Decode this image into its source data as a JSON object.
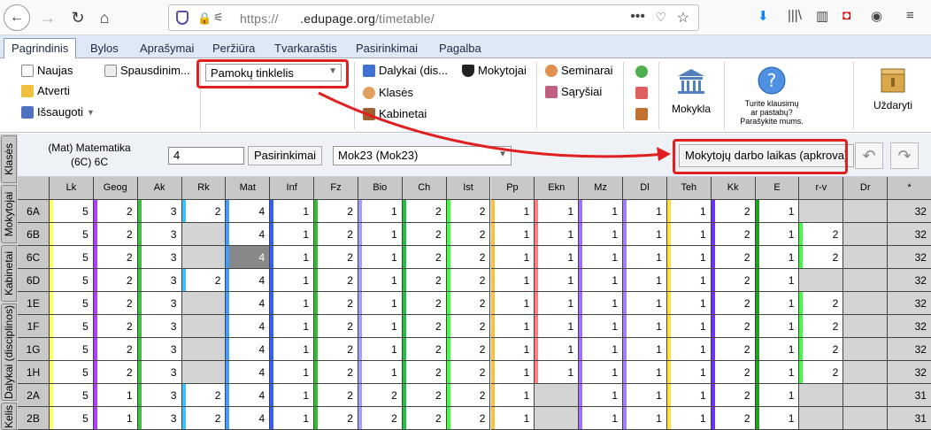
{
  "browser": {
    "url_prefix": "https://",
    "url_host": ".edupage.org",
    "url_path": "/timetable/"
  },
  "menu": {
    "tabs": [
      "Pagrindinis",
      "Bylos",
      "Aprašymai",
      "Peržiūra",
      "Tvarkaraštis",
      "Pasirinkimai",
      "Pagalba"
    ],
    "active": "Pagrindinis"
  },
  "ribbon": {
    "naujas": "Naujas",
    "atverti": "Atverti",
    "issaugoti": "Išsaugoti",
    "spausdinimas": "Spausdinim...",
    "view_select": "Pamokų tinklelis",
    "dalykai": "Dalykai (dis...",
    "klases": "Klasės",
    "kabinetai": "Kabinetai",
    "mokytojai": "Mokytojai",
    "seminarai": "Seminarai",
    "sarysiai": "Sąryšiai",
    "mokykla": "Mokykla",
    "help_line1": "Turite klausimų",
    "help_line2": "ar pastabų?",
    "help_line3": "Parašykite mums.",
    "uzdaryti": "Uždaryti"
  },
  "filter": {
    "subject_line1": "(Mat) Matematika",
    "subject_line2": "(6C) 6C",
    "number_value": "4",
    "pasirinkimai": "Pasirinkimai",
    "teacher_select": "Mok23 (Mok23)",
    "workload_button": "Mokytojų darbo laikas (apkrova)"
  },
  "sidetabs": [
    "Klasės",
    "Mokytojai",
    "Kabinetai",
    "Dalykai (disciplinos)",
    "Kelis"
  ],
  "grid": {
    "columns": [
      "Lk",
      "Geog",
      "Ak",
      "Rk",
      "Mat",
      "Inf",
      "Fz",
      "Bio",
      "Ch",
      "Ist",
      "Pp",
      "Ekn",
      "Mz",
      "Dl",
      "Teh",
      "Kk",
      "E",
      "r-v",
      "Dr",
      "*"
    ],
    "column_colors": [
      "#ffff66",
      "#b040ff",
      "#40c040",
      "#40c0ff",
      "#40a0ff",
      "#3060ff",
      "#30c030",
      "#a0a0ff",
      "#20c040",
      "#40ff40",
      "#ffc040",
      "#ff8080",
      "#a070ff",
      "#a080ff",
      "#ffe040",
      "#7030ff",
      "#20a020",
      "#40ff40",
      "#cccccc",
      "#cccccc"
    ],
    "rows": [
      {
        "label": "6A",
        "cells": [
          "5",
          "2",
          "3",
          "2",
          "4",
          "1",
          "2",
          "1",
          "2",
          "2",
          "1",
          "1",
          "1",
          "1",
          "1",
          "2",
          "1",
          "",
          "",
          "32"
        ]
      },
      {
        "label": "6B",
        "cells": [
          "5",
          "2",
          "3",
          "",
          "4",
          "1",
          "2",
          "1",
          "2",
          "2",
          "1",
          "1",
          "1",
          "1",
          "1",
          "2",
          "1",
          "2",
          "",
          "32"
        ]
      },
      {
        "label": "6C",
        "cells": [
          "5",
          "2",
          "3",
          "",
          "4",
          "1",
          "2",
          "1",
          "2",
          "2",
          "1",
          "1",
          "1",
          "1",
          "1",
          "2",
          "1",
          "2",
          "",
          "32"
        ]
      },
      {
        "label": "6D",
        "cells": [
          "5",
          "2",
          "3",
          "2",
          "4",
          "1",
          "2",
          "1",
          "2",
          "2",
          "1",
          "1",
          "1",
          "1",
          "1",
          "2",
          "1",
          "",
          "",
          "32"
        ]
      },
      {
        "label": "1E",
        "cells": [
          "5",
          "2",
          "3",
          "",
          "4",
          "1",
          "2",
          "1",
          "2",
          "2",
          "1",
          "1",
          "1",
          "1",
          "1",
          "2",
          "1",
          "2",
          "",
          "32"
        ]
      },
      {
        "label": "1F",
        "cells": [
          "5",
          "2",
          "3",
          "",
          "4",
          "1",
          "2",
          "1",
          "2",
          "2",
          "1",
          "1",
          "1",
          "1",
          "1",
          "2",
          "1",
          "2",
          "",
          "32"
        ]
      },
      {
        "label": "1G",
        "cells": [
          "5",
          "2",
          "3",
          "",
          "4",
          "1",
          "2",
          "1",
          "2",
          "2",
          "1",
          "1",
          "1",
          "1",
          "1",
          "2",
          "1",
          "2",
          "",
          "32"
        ]
      },
      {
        "label": "1H",
        "cells": [
          "5",
          "2",
          "3",
          "",
          "4",
          "1",
          "2",
          "1",
          "2",
          "2",
          "1",
          "1",
          "1",
          "1",
          "1",
          "2",
          "1",
          "2",
          "",
          "32"
        ]
      },
      {
        "label": "2A",
        "cells": [
          "5",
          "1",
          "3",
          "2",
          "4",
          "1",
          "2",
          "2",
          "2",
          "2",
          "1",
          "",
          "1",
          "1",
          "1",
          "2",
          "1",
          "",
          "",
          "31"
        ]
      },
      {
        "label": "2B",
        "cells": [
          "5",
          "1",
          "3",
          "2",
          "4",
          "1",
          "2",
          "2",
          "2",
          "2",
          "1",
          "",
          "1",
          "1",
          "1",
          "2",
          "1",
          "",
          "",
          "31"
        ]
      }
    ]
  }
}
